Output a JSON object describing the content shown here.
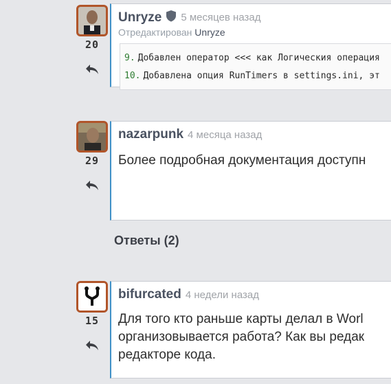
{
  "comments": [
    {
      "user": "Unryze",
      "time": "5 месяцев назад",
      "edited_prefix": "Отредактирован",
      "edited_by": "Unryze",
      "votes": "20",
      "code_lines": [
        {
          "num": "9.",
          "text": "Добавлен оператор <<< как Логическия операция"
        },
        {
          "num": "10.",
          "text": "Добавлена опция RunTimers в settings.ini, эт"
        }
      ]
    },
    {
      "user": "nazarpunk",
      "time": "4 месяца назад",
      "votes": "29",
      "text": "Более подробная документация доступн"
    },
    {
      "user": "bifurcated",
      "time": "4 недели назад",
      "votes": "15",
      "lines": [
        "Для того кто раньше карты делал в Worl",
        "организовывается работа? Как вы редак",
        "редакторе кода."
      ]
    }
  ],
  "answers_label": "Ответы (2)",
  "colors": {
    "accent": "#3f90c7",
    "avatar_border": "#b1552a",
    "background": "#e6e7ea"
  },
  "icons": {
    "reply": "reply-arrow-icon",
    "shield": "shield-icon"
  }
}
